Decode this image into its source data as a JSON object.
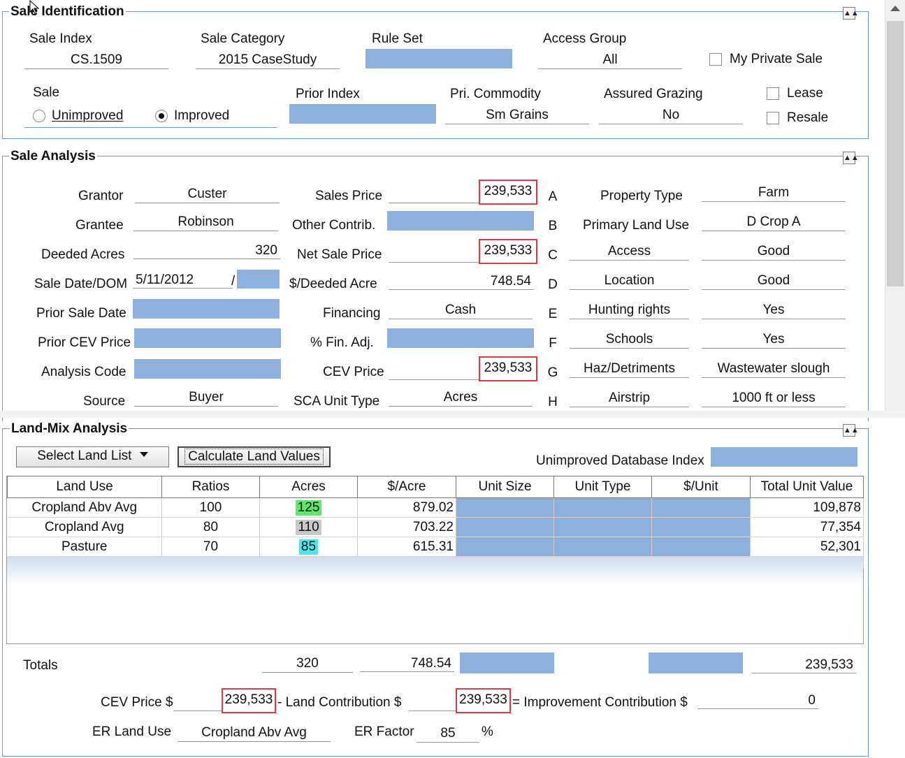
{
  "sale_identification": {
    "title": "Sale Identification",
    "sale_index_label": "Sale Index",
    "sale_index_value": "CS.1509",
    "sale_category_label": "Sale Category",
    "sale_category_value": "2015 CaseStudy",
    "rule_set_label": "Rule Set",
    "access_group_label": "Access Group",
    "access_group_value": "All",
    "my_private_sale_label": "My Private Sale",
    "sale_label": "Sale",
    "unimproved_label": "Unimproved",
    "improved_label": "Improved",
    "prior_index_label": "Prior Index",
    "pri_commodity_label": "Pri. Commodity",
    "pri_commodity_value": "Sm Grains",
    "assured_grazing_label": "Assured Grazing",
    "assured_grazing_value": "No",
    "lease_label": "Lease",
    "resale_label": "Resale"
  },
  "sale_analysis": {
    "title": "Sale Analysis",
    "grantor_label": "Grantor",
    "grantor_value": "Custer",
    "grantee_label": "Grantee",
    "grantee_value": "Robinson",
    "deeded_acres_label": "Deeded Acres",
    "deeded_acres_value": "320",
    "sale_date_label": "Sale Date/DOM",
    "sale_date_value": "5/11/2012",
    "sale_date_sep": "/",
    "prior_sale_date_label": "Prior Sale Date",
    "prior_cev_price_label": "Prior CEV Price",
    "analysis_code_label": "Analysis Code",
    "source_label": "Source",
    "source_value": "Buyer",
    "sales_price_label": "Sales Price",
    "sales_price_value": "239,533",
    "other_contrib_label": "Other Contrib.",
    "net_sale_price_label": "Net Sale Price",
    "net_sale_price_value": "239,533",
    "per_deeded_acre_label": "$/Deeded Acre",
    "per_deeded_acre_value": "748.54",
    "financing_label": "Financing",
    "financing_value": "Cash",
    "fin_adj_label": "% Fin. Adj.",
    "cev_price_label": "CEV Price",
    "cev_price_value": "239,533",
    "sca_unit_type_label": "SCA Unit Type",
    "sca_unit_type_value": "Acres",
    "letters": [
      "A",
      "B",
      "C",
      "D",
      "E",
      "F",
      "G",
      "H"
    ],
    "attributes": [
      {
        "name": "Property Type",
        "value": "Farm"
      },
      {
        "name": "Primary Land Use",
        "value": "D Crop A"
      },
      {
        "name": "Access",
        "value": "Good"
      },
      {
        "name": "Location",
        "value": "Good"
      },
      {
        "name": "Hunting rights",
        "value": "Yes"
      },
      {
        "name": "Schools",
        "value": "Yes"
      },
      {
        "name": "Haz/Detriments",
        "value": "Wastewater slough"
      },
      {
        "name": "Airstrip",
        "value": "1000 ft or less"
      }
    ]
  },
  "land_mix": {
    "title": "Land-Mix Analysis",
    "select_land_list_label": "Select Land List",
    "calculate_label": "Calculate Land Values",
    "unimproved_db_index_label": "Unimproved Database Index",
    "columns": [
      "Land Use",
      "Ratios",
      "Acres",
      "$/Acre",
      "Unit Size",
      "Unit Type",
      "$/Unit",
      "Total Unit Value"
    ],
    "rows": [
      {
        "land_use": "Cropland Abv Avg",
        "ratio": "100",
        "acres": "125",
        "per_acre": "879.02",
        "total": "109,878",
        "acres_color": "#5ee86e"
      },
      {
        "land_use": "Cropland Avg",
        "ratio": "80",
        "acres": "110",
        "per_acre": "703.22",
        "total": "77,354",
        "acres_color": "#c9c9c9"
      },
      {
        "land_use": "Pasture",
        "ratio": "70",
        "acres": "85",
        "per_acre": "615.31",
        "total": "52,301",
        "acres_color": "#52e2ee"
      }
    ],
    "totals_label": "Totals",
    "totals_acres": "320",
    "totals_per_acre": "748.54",
    "totals_total": "239,533",
    "cev_price_label": "CEV Price $",
    "cev_price_value": "239,533",
    "land_contribution_label": "- Land Contribution $",
    "land_contribution_value": "239,533",
    "improvement_contribution_label": "= Improvement Contribution $",
    "improvement_contribution_value": "0",
    "er_land_use_label": "ER Land Use",
    "er_land_use_value": "Cropland Abv Avg",
    "er_factor_label": "ER Factor",
    "er_factor_value": "85",
    "percent_sign": "%"
  },
  "colors": {
    "field_blue": "#8eb0dd",
    "group_border": "#6e98c8",
    "highlight_red": "#e0383e"
  },
  "icons": {
    "collapse": "double-chevron-up-icon",
    "dropdown": "triangle-down-icon",
    "cursor": "mouse-pointer-icon"
  }
}
